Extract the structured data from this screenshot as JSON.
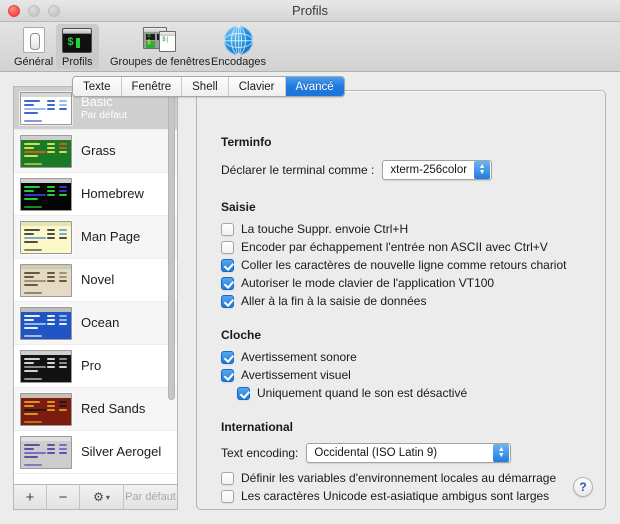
{
  "window": {
    "title": "Profils",
    "traffic_lights": [
      "close",
      "minimize",
      "zoom"
    ]
  },
  "toolbar": {
    "items": [
      {
        "label": "Général",
        "icon": "general-icon",
        "selected": false
      },
      {
        "label": "Profils",
        "icon": "terminal-icon",
        "selected": true
      },
      {
        "label": "Groupes de fenêtres",
        "icon": "window-groups-icon",
        "selected": false
      },
      {
        "label": "Encodages",
        "icon": "globe-icon",
        "selected": false
      }
    ]
  },
  "sidebar": {
    "profiles": [
      {
        "name": "Basic",
        "subtitle": "Par défaut",
        "selected": true,
        "bg": "#ffffff",
        "fg": "#2a56c6",
        "accent": "#8ab6e8",
        "titlebar": "#d8d8d8"
      },
      {
        "name": "Grass",
        "subtitle": "",
        "selected": false,
        "bg": "#1a7a25",
        "fg": "#e8e860",
        "accent": "#e05a20",
        "titlebar": "#cfcfcf"
      },
      {
        "name": "Homebrew",
        "subtitle": "",
        "selected": false,
        "bg": "#050505",
        "fg": "#2ee03a",
        "accent": "#3b3bd6",
        "titlebar": "#cfcfcf"
      },
      {
        "name": "Man Page",
        "subtitle": "",
        "selected": false,
        "bg": "#fcf8c8",
        "fg": "#3b3b3b",
        "accent": "#6f9fd8",
        "titlebar": "#e6e2b4"
      },
      {
        "name": "Novel",
        "subtitle": "",
        "selected": false,
        "bg": "#e3dbc4",
        "fg": "#5a4a38",
        "accent": "#a08a6a",
        "titlebar": "#cfcab4"
      },
      {
        "name": "Ocean",
        "subtitle": "",
        "selected": false,
        "bg": "#1f55c4",
        "fg": "#ffffff",
        "accent": "#9ec4f5",
        "titlebar": "#bcbcbc"
      },
      {
        "name": "Pro",
        "subtitle": "",
        "selected": false,
        "bg": "#121212",
        "fg": "#e8e8e8",
        "accent": "#9a9a9a",
        "titlebar": "#cfcfcf"
      },
      {
        "name": "Red Sands",
        "subtitle": "",
        "selected": false,
        "bg": "#7a1c10",
        "fg": "#e8a020",
        "accent": "#1a1a1a",
        "titlebar": "#c9c0b4"
      },
      {
        "name": "Silver Aerogel",
        "subtitle": "",
        "selected": false,
        "bg": "#cdcdcd",
        "fg": "#5a3fa0",
        "accent": "#7a5ec0",
        "titlebar": "#e0e0e0"
      }
    ],
    "buttons": {
      "add": "+",
      "remove": "−",
      "gear": "⚙",
      "gear_chevron": "▾",
      "default_label": "Par défaut"
    }
  },
  "tabs": [
    {
      "label": "Texte",
      "active": false
    },
    {
      "label": "Fenêtre",
      "active": false
    },
    {
      "label": "Shell",
      "active": false
    },
    {
      "label": "Clavier",
      "active": false
    },
    {
      "label": "Avancé",
      "active": true
    }
  ],
  "panel": {
    "terminfo": {
      "heading": "Terminfo",
      "declare_label": "Déclarer le terminal comme :",
      "declare_value": "xterm-256color"
    },
    "saisie": {
      "heading": "Saisie",
      "options": [
        {
          "label": "La touche Suppr. envoie Ctrl+H",
          "checked": false,
          "indent": false
        },
        {
          "label": "Encoder par échappement l'entrée non ASCII avec Ctrl+V",
          "checked": false,
          "indent": false
        },
        {
          "label": "Coller les caractères de nouvelle ligne comme retours chariot",
          "checked": true,
          "indent": false
        },
        {
          "label": "Autoriser le mode clavier de l'application VT100",
          "checked": true,
          "indent": false
        },
        {
          "label": "Aller à la fin à la saisie de données",
          "checked": true,
          "indent": false
        }
      ]
    },
    "cloche": {
      "heading": "Cloche",
      "options": [
        {
          "label": "Avertissement sonore",
          "checked": true,
          "indent": false
        },
        {
          "label": "Avertissement visuel",
          "checked": true,
          "indent": false
        },
        {
          "label": "Uniquement quand le son est désactivé",
          "checked": true,
          "indent": true
        }
      ]
    },
    "international": {
      "heading": "International",
      "encoding_label": "Text encoding:",
      "encoding_value": "Occidental (ISO Latin 9)",
      "options": [
        {
          "label": "Définir les variables d'environnement locales au démarrage",
          "checked": false,
          "indent": false
        },
        {
          "label": "Les caractères Unicode est-asiatique ambigus sont larges",
          "checked": false,
          "indent": false
        }
      ]
    },
    "help_label": "?"
  },
  "colors": {
    "accent_blue": "#1d7bdd",
    "selected_row": "#cfcfcf",
    "window_bg": "#ececec"
  }
}
